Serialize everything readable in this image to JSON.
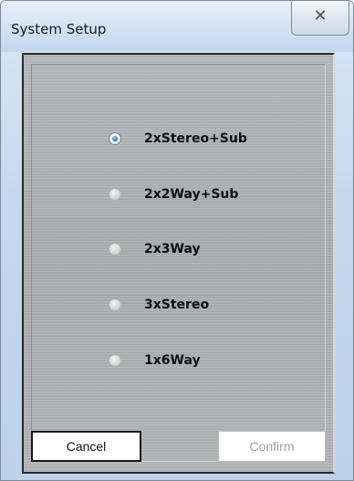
{
  "window": {
    "title": "System Setup",
    "close_glyph": "✕"
  },
  "options": [
    {
      "label": "2xStereo+Sub",
      "selected": true
    },
    {
      "label": "2x2Way+Sub",
      "selected": false
    },
    {
      "label": "2x3Way",
      "selected": false
    },
    {
      "label": "3xStereo",
      "selected": false
    },
    {
      "label": "1x6Way",
      "selected": false
    }
  ],
  "buttons": {
    "cancel_label": "Cancel",
    "confirm_label": "Confirm",
    "confirm_enabled": false
  },
  "colors": {
    "radio_selected": "#2f6fa6",
    "panel_bg": "#b4b6b9",
    "disabled_text": "#a0a0a0"
  }
}
